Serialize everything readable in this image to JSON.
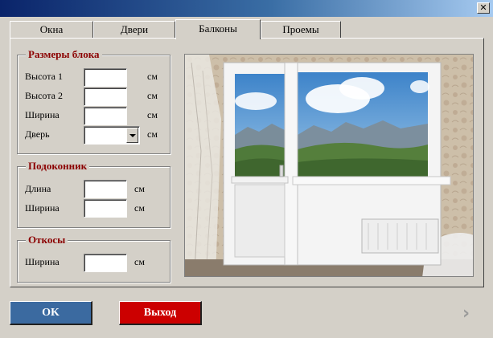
{
  "titlebar": {
    "close_glyph": "✕"
  },
  "tabs": [
    {
      "label": "Окна",
      "active": false
    },
    {
      "label": "Двери",
      "active": false
    },
    {
      "label": "Балконы",
      "active": true
    },
    {
      "label": "Проемы",
      "active": false
    }
  ],
  "block_size": {
    "title": "Размеры блока",
    "height1_label": "Высота 1",
    "height2_label": "Высота 2",
    "width_label": "Ширина",
    "door_label": "Дверь",
    "height1_value": "",
    "height2_value": "",
    "width_value": "",
    "door_value": "",
    "unit": "см"
  },
  "sill": {
    "title": "Подоконник",
    "length_label": "Длина",
    "width_label": "Ширина",
    "length_value": "",
    "width_value": "",
    "unit": "см"
  },
  "slopes": {
    "title": "Откосы",
    "width_label": "Ширина",
    "width_value": "",
    "unit": "см"
  },
  "buttons": {
    "ok": "OK",
    "exit": "Выход"
  },
  "nav": {
    "next_glyph": "›"
  },
  "colors": {
    "accent_title": "#8b0000",
    "ok_button": "#3b6aa0",
    "exit_button": "#cc0000"
  }
}
